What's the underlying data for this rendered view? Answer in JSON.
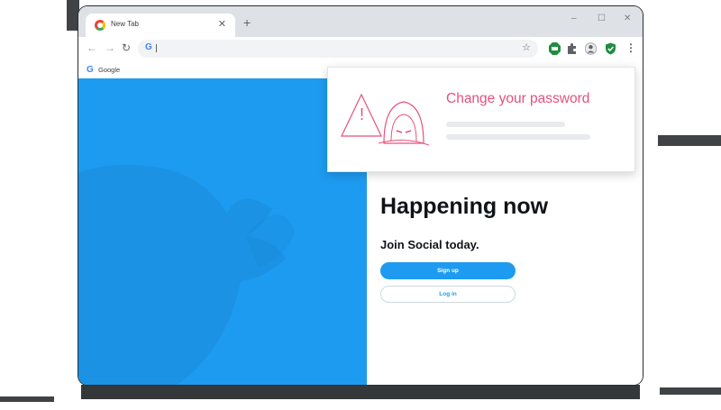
{
  "browser": {
    "tab": {
      "title": "New Tab",
      "close_glyph": "✕"
    },
    "new_tab_glyph": "+",
    "window_controls": {
      "minimize": "–",
      "maximize": "☐",
      "close": "✕"
    },
    "toolbar": {
      "back_glyph": "←",
      "forward_glyph": "→",
      "reload_glyph": "↻",
      "omnibox_value": "",
      "omnibox_g": "G",
      "star_glyph": "☆",
      "extensions": [
        "adblock-icon",
        "puzzle-extensions-icon",
        "profile-icon",
        "shield-check-icon"
      ],
      "menu_glyph": "⋮"
    },
    "bookmarks": {
      "g": "G",
      "label": "Google"
    }
  },
  "page": {
    "headline": "Happening now",
    "subheadline": "Join Social today.",
    "signup_label": "Sign up",
    "login_label": "Log in"
  },
  "alert": {
    "title": "Change your password",
    "warning_glyph": "!",
    "icon": "hooded-hacker-warning-icon"
  },
  "colors": {
    "brand_blue": "#1d9bf0",
    "alert_pink": "#e8507b"
  }
}
